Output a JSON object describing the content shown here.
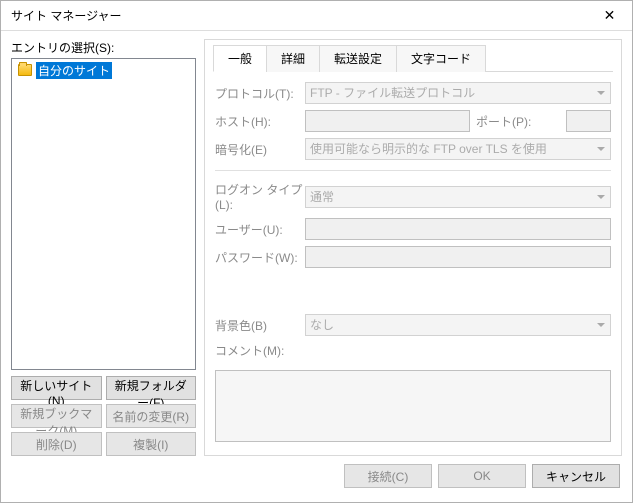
{
  "window": {
    "title": "サイト マネージャー"
  },
  "left": {
    "entry_label": "エントリの選択(S):",
    "tree_item": "自分のサイト",
    "buttons": {
      "new_site": "新しいサイト(N)",
      "new_folder": "新規フォルダー(F)",
      "new_bookmark": "新規ブックマーク(M)",
      "rename": "名前の変更(R)",
      "delete": "削除(D)",
      "duplicate": "複製(I)"
    }
  },
  "tabs": {
    "general": "一般",
    "detail": "詳細",
    "transfer": "転送設定",
    "charset": "文字コード"
  },
  "form": {
    "protocol_lbl": "プロトコル(T):",
    "protocol_val": "FTP - ファイル転送プロトコル",
    "host_lbl": "ホスト(H):",
    "port_lbl": "ポート(P):",
    "encrypt_lbl": "暗号化(E)",
    "encrypt_val": "使用可能なら明示的な FTP over TLS を使用",
    "logon_lbl": "ログオン タイプ(L):",
    "logon_val": "通常",
    "user_lbl": "ユーザー(U):",
    "pass_lbl": "パスワード(W):",
    "bg_lbl": "背景色(B)",
    "bg_val": "なし",
    "comment_lbl": "コメント(M):"
  },
  "footer": {
    "connect": "接続(C)",
    "ok": "OK",
    "cancel": "キャンセル"
  }
}
